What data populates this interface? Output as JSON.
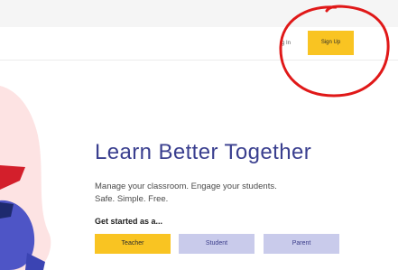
{
  "header": {
    "login_label": "g In",
    "signup_label": "Sign Up"
  },
  "hero": {
    "title": "Learn Better Together",
    "subtitle_line1": "Manage your classroom. Engage your students.",
    "subtitle_line2": "Safe. Simple. Free."
  },
  "roles": {
    "prompt": "Get started as a...",
    "teacher": "Teacher",
    "student": "Student",
    "parent": "Parent"
  },
  "colors": {
    "accent_yellow": "#f9c422",
    "title_purple": "#3a3f8f",
    "role_lilac": "#c9cbeb",
    "annotation_red": "#e01818"
  }
}
